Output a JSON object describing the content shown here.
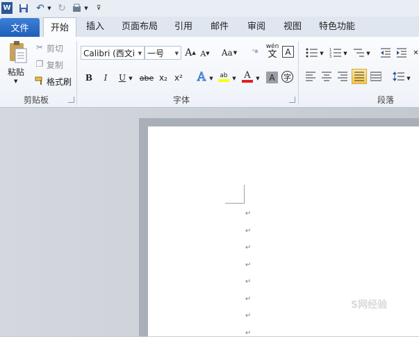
{
  "qat": {
    "app_icon": "word-app-icon",
    "items": [
      "save-icon",
      "undo-icon",
      "redo-icon",
      "print-preview-icon",
      "customize-qat-icon"
    ]
  },
  "tabs": {
    "file": "文件",
    "items": [
      "开始",
      "插入",
      "页面布局",
      "引用",
      "邮件",
      "审阅",
      "视图",
      "特色功能"
    ],
    "active": "开始"
  },
  "clipboard": {
    "paste": "粘贴",
    "cut": "剪切",
    "copy": "复制",
    "format_painter": "格式刷",
    "group_label": "剪贴板"
  },
  "font": {
    "font_name": "Calibri (西文i",
    "font_size": "一号",
    "grow": "A",
    "shrink": "A",
    "change_case": "Aa",
    "bold": "B",
    "italic": "I",
    "underline": "U",
    "strike": "abe",
    "subscript": "x₂",
    "superscript": "x²",
    "text_effect": "A",
    "highlight": "ab",
    "font_color": "A",
    "char_shading": "A",
    "enclose": "字",
    "wen": "wén",
    "phonetic": "文",
    "group_label": "字体"
  },
  "paragraph": {
    "group_label": "段落"
  },
  "document": {
    "paragraph_mark": "↵",
    "mark_count": 8
  },
  "watermark": "S网经验"
}
